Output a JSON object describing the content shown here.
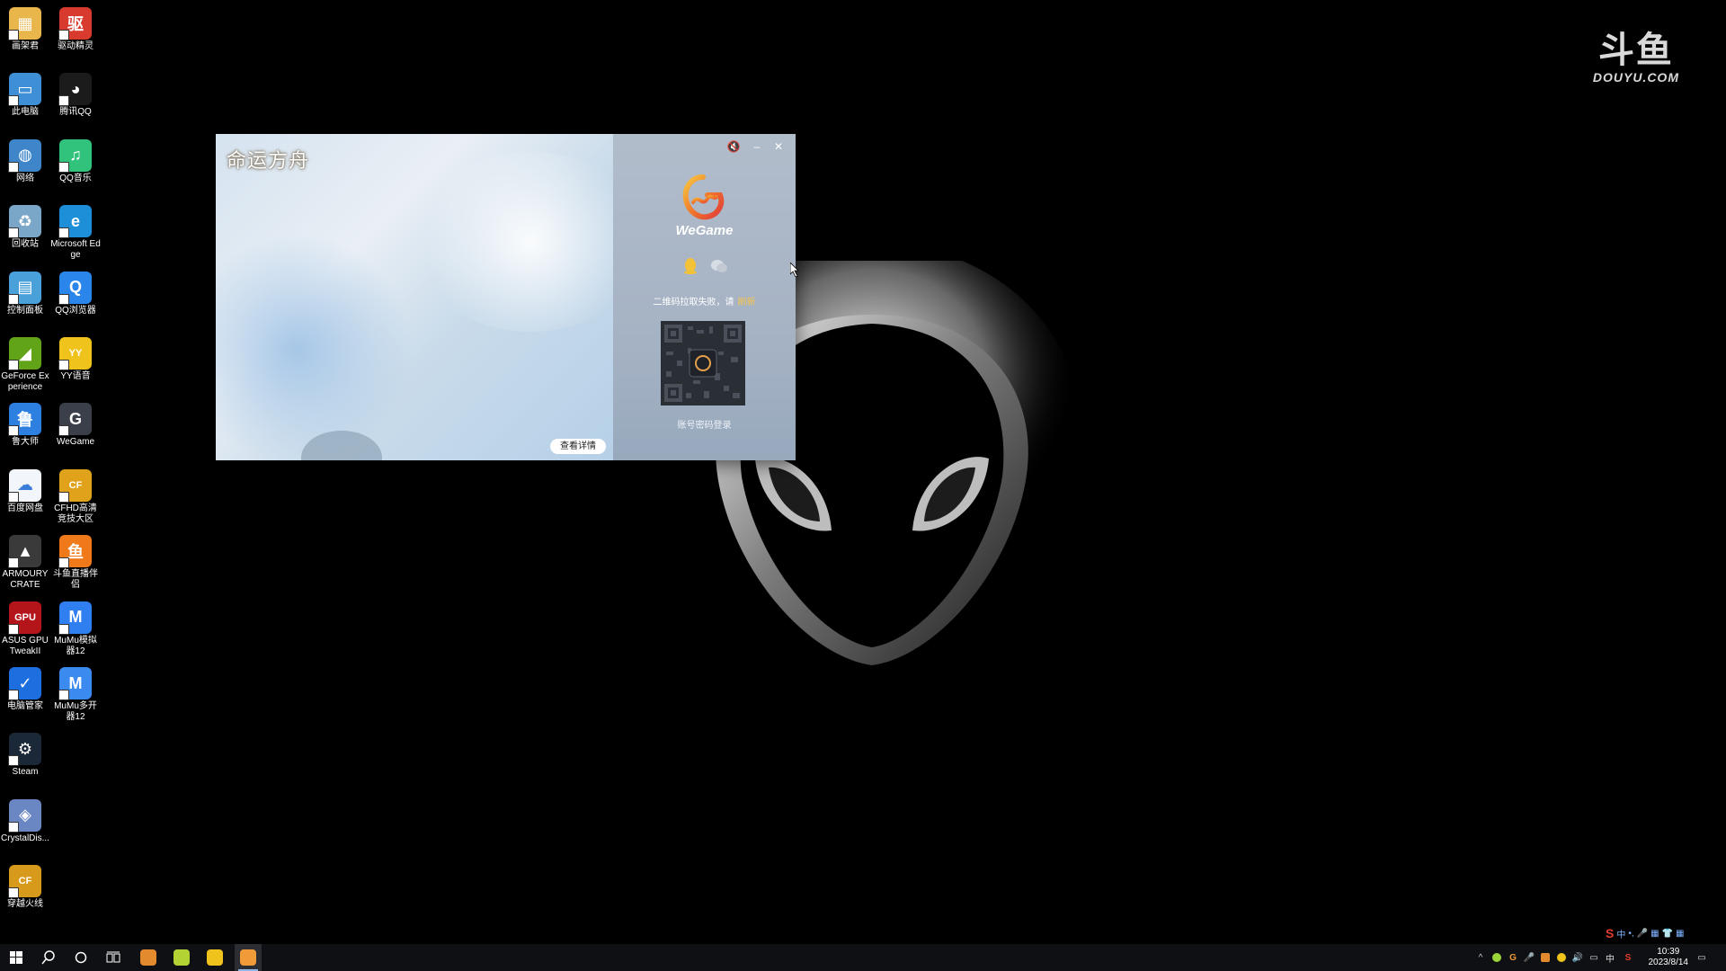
{
  "desktop": {
    "icons": [
      {
        "label": "画架君",
        "icon": "folder-user-icon",
        "color": "#e8b64a",
        "glyph": "▦"
      },
      {
        "label": "驱动精灵",
        "icon": "driver-genius-icon",
        "color": "#d83a2e",
        "glyph": "驱"
      },
      {
        "label": "此电脑",
        "icon": "this-pc-icon",
        "color": "#3f8fd6",
        "glyph": "▭"
      },
      {
        "label": "腾讯QQ",
        "icon": "qq-penguin-icon",
        "color": "#1b1b1b",
        "glyph": "◕"
      },
      {
        "label": "网络",
        "icon": "network-icon",
        "color": "#3e86c9",
        "glyph": "◍"
      },
      {
        "label": "QQ音乐",
        "icon": "qq-music-icon",
        "color": "#31c27c",
        "glyph": "♫"
      },
      {
        "label": "回收站",
        "icon": "recycle-bin-icon",
        "color": "#7aa6c8",
        "glyph": "♻"
      },
      {
        "label": "Microsoft Edge",
        "icon": "edge-icon",
        "color": "#1c8fd8",
        "glyph": "e"
      },
      {
        "label": "控制面板",
        "icon": "control-panel-icon",
        "color": "#4aa0d9",
        "glyph": "▤"
      },
      {
        "label": "QQ浏览器",
        "icon": "qq-browser-icon",
        "color": "#2a86ea",
        "glyph": "Q"
      },
      {
        "label": "GeForce Experience",
        "icon": "geforce-icon",
        "color": "#62a418",
        "glyph": "◢"
      },
      {
        "label": "YY语音",
        "icon": "yy-voice-icon",
        "color": "#f0c21c",
        "glyph": "YY"
      },
      {
        "label": "鲁大师",
        "icon": "ludashi-icon",
        "color": "#2d7fe0",
        "glyph": "鲁"
      },
      {
        "label": "WeGame",
        "icon": "wegame-icon",
        "color": "#3a3f4a",
        "glyph": "G"
      },
      {
        "label": "百度网盘",
        "icon": "baidu-netdisk-icon",
        "color": "#f2f6fb",
        "glyph": "☁"
      },
      {
        "label": "CFHD高清竞技大区",
        "icon": "cfhd-icon",
        "color": "#e0a21a",
        "glyph": "CF"
      },
      {
        "label": "ARMOURY CRATE",
        "icon": "armoury-crate-icon",
        "color": "#3a3a3a",
        "glyph": "▲"
      },
      {
        "label": "斗鱼直播伴侣",
        "icon": "douyu-companion-icon",
        "color": "#f07a1a",
        "glyph": "鱼"
      },
      {
        "label": "ASUS GPU TweakII",
        "icon": "asus-gpu-tweak-icon",
        "color": "#b3151b",
        "glyph": "GPU"
      },
      {
        "label": "MuMu模拟器12",
        "icon": "mumu-emulator-icon",
        "color": "#2f7ff0",
        "glyph": "M"
      },
      {
        "label": "电脑管家",
        "icon": "pc-manager-icon",
        "color": "#1d6fe0",
        "glyph": "✓"
      },
      {
        "label": "MuMu多开器12",
        "icon": "mumu-multi-icon",
        "color": "#3a8af0",
        "glyph": "M"
      },
      {
        "label": "Steam",
        "icon": "steam-icon",
        "color": "#1b2838",
        "glyph": "⚙"
      },
      {
        "label": "CrystalDis...",
        "icon": "crystaldisk-icon",
        "color": "#6a87c4",
        "glyph": "◈"
      },
      {
        "label": "穿越火线",
        "icon": "crossfire-icon",
        "color": "#d89a1a",
        "glyph": "CF"
      }
    ]
  },
  "watermark": {
    "logo": "斗鱼",
    "text": "DOUYU.COM"
  },
  "wegame_window": {
    "game_title": "命运方舟",
    "details_button": "查看详情",
    "brand": "WeGame",
    "qr_message": "二维码拉取失败，请",
    "qr_refresh": "刷新",
    "account_login": "账号密码登录",
    "controls": {
      "mute": "🔇",
      "minimize": "–",
      "close": "✕"
    },
    "login_icons": [
      "qq-login-icon",
      "wechat-login-icon"
    ]
  },
  "taskbar": {
    "start_icon": "windows-start-icon",
    "search_icon": "search-icon",
    "cortana_icon": "cortana-icon",
    "taskview_icon": "task-view-icon",
    "pinned": [
      {
        "name": "taskbar-app-douyu",
        "icon": "douyu-app-icon",
        "color": "#e38a2e"
      },
      {
        "name": "taskbar-app-geforce",
        "icon": "qq-music-app-icon",
        "color": "#b3d334"
      },
      {
        "name": "taskbar-app-yy",
        "icon": "yy-app-icon",
        "color": "#f0c21c"
      },
      {
        "name": "taskbar-app-wegame",
        "icon": "wegame-app-icon",
        "color": "#f09a3a"
      }
    ],
    "clock_time": "10:39",
    "clock_date": "2023/8/14",
    "ime_lang": "中",
    "tray_lang": "中",
    "ime_items": [
      "中",
      "•,",
      "🎤",
      "▦",
      "👕",
      "▦"
    ]
  }
}
